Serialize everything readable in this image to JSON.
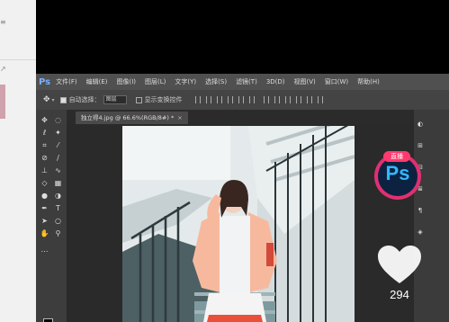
{
  "app": {
    "logo": "Ps"
  },
  "menu": [
    "文件(F)",
    "编辑(E)",
    "图像(I)",
    "图层(L)",
    "文字(Y)",
    "选择(S)",
    "滤镜(T)",
    "3D(D)",
    "视图(V)",
    "窗口(W)",
    "帮助(H)"
  ],
  "options": {
    "auto_select_label": "自动选择：",
    "auto_select_value": "图层",
    "transform_label": "显示变换控件"
  },
  "document": {
    "tab_label": "独立得4.jpg @ 66.6%(RGB/8#) *",
    "close": "×"
  },
  "overlay": {
    "badge_live": "直播",
    "badge_ps": "Ps",
    "like_count": "294",
    "colors": {
      "accent": "#e03070",
      "ps_blue": "#33b7ff"
    }
  },
  "icons": [
    "move-icon",
    "marquee-icon",
    "lasso-icon",
    "magic-wand-icon",
    "crop-icon",
    "eyedropper-icon",
    "healing-icon",
    "brush-icon",
    "stamp-icon",
    "history-brush-icon",
    "eraser-icon",
    "gradient-icon",
    "blur-icon",
    "dodge-icon",
    "pen-icon",
    "text-icon",
    "path-select-icon",
    "shape-icon",
    "hand-icon",
    "zoom-icon",
    "heart-icon"
  ]
}
